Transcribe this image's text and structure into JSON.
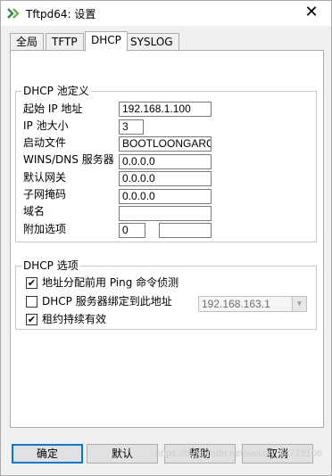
{
  "window": {
    "title": "Tftpd64: 设置",
    "close_label": "✕"
  },
  "tabs": [
    {
      "label": "全局"
    },
    {
      "label": "TFTP"
    },
    {
      "label": "DHCP"
    },
    {
      "label": "SYSLOG"
    }
  ],
  "active_tab": "DHCP",
  "pool": {
    "legend": "DHCP 池定义",
    "fields": [
      {
        "label": "起始 IP 地址",
        "value": "192.168.1.100"
      },
      {
        "label": "IP 池大小",
        "value": "3"
      },
      {
        "label": "启动文件",
        "value": "BOOTLOONGARCH"
      },
      {
        "label": "WINS/DNS 服务器",
        "value": "0.0.0.0"
      },
      {
        "label": "默认网关",
        "value": "0.0.0.0"
      },
      {
        "label": "子网掩码",
        "value": "0.0.0.0"
      },
      {
        "label": "域名",
        "value": ""
      },
      {
        "label": "附加选项",
        "value": "0",
        "value2": ""
      }
    ]
  },
  "options": {
    "legend": "DHCP 选项",
    "items": [
      {
        "label": "地址分配前用 Ping 命令侦测",
        "checked": true,
        "mark": "✔"
      },
      {
        "label": "DHCP 服务器绑定到此地址",
        "checked": false,
        "mark": ""
      },
      {
        "label": "租约持续有效",
        "checked": true,
        "mark": "✔"
      }
    ],
    "bind_address": "192.168.163.1"
  },
  "buttons": {
    "ok": "确定",
    "default": "默认",
    "help": "帮助",
    "cancel": "取消"
  },
  "watermark": "https://blog.csdn.net/weixin_44773106",
  "colors": {
    "accent": "#0078d7",
    "icon_green": "#2e8b57"
  }
}
